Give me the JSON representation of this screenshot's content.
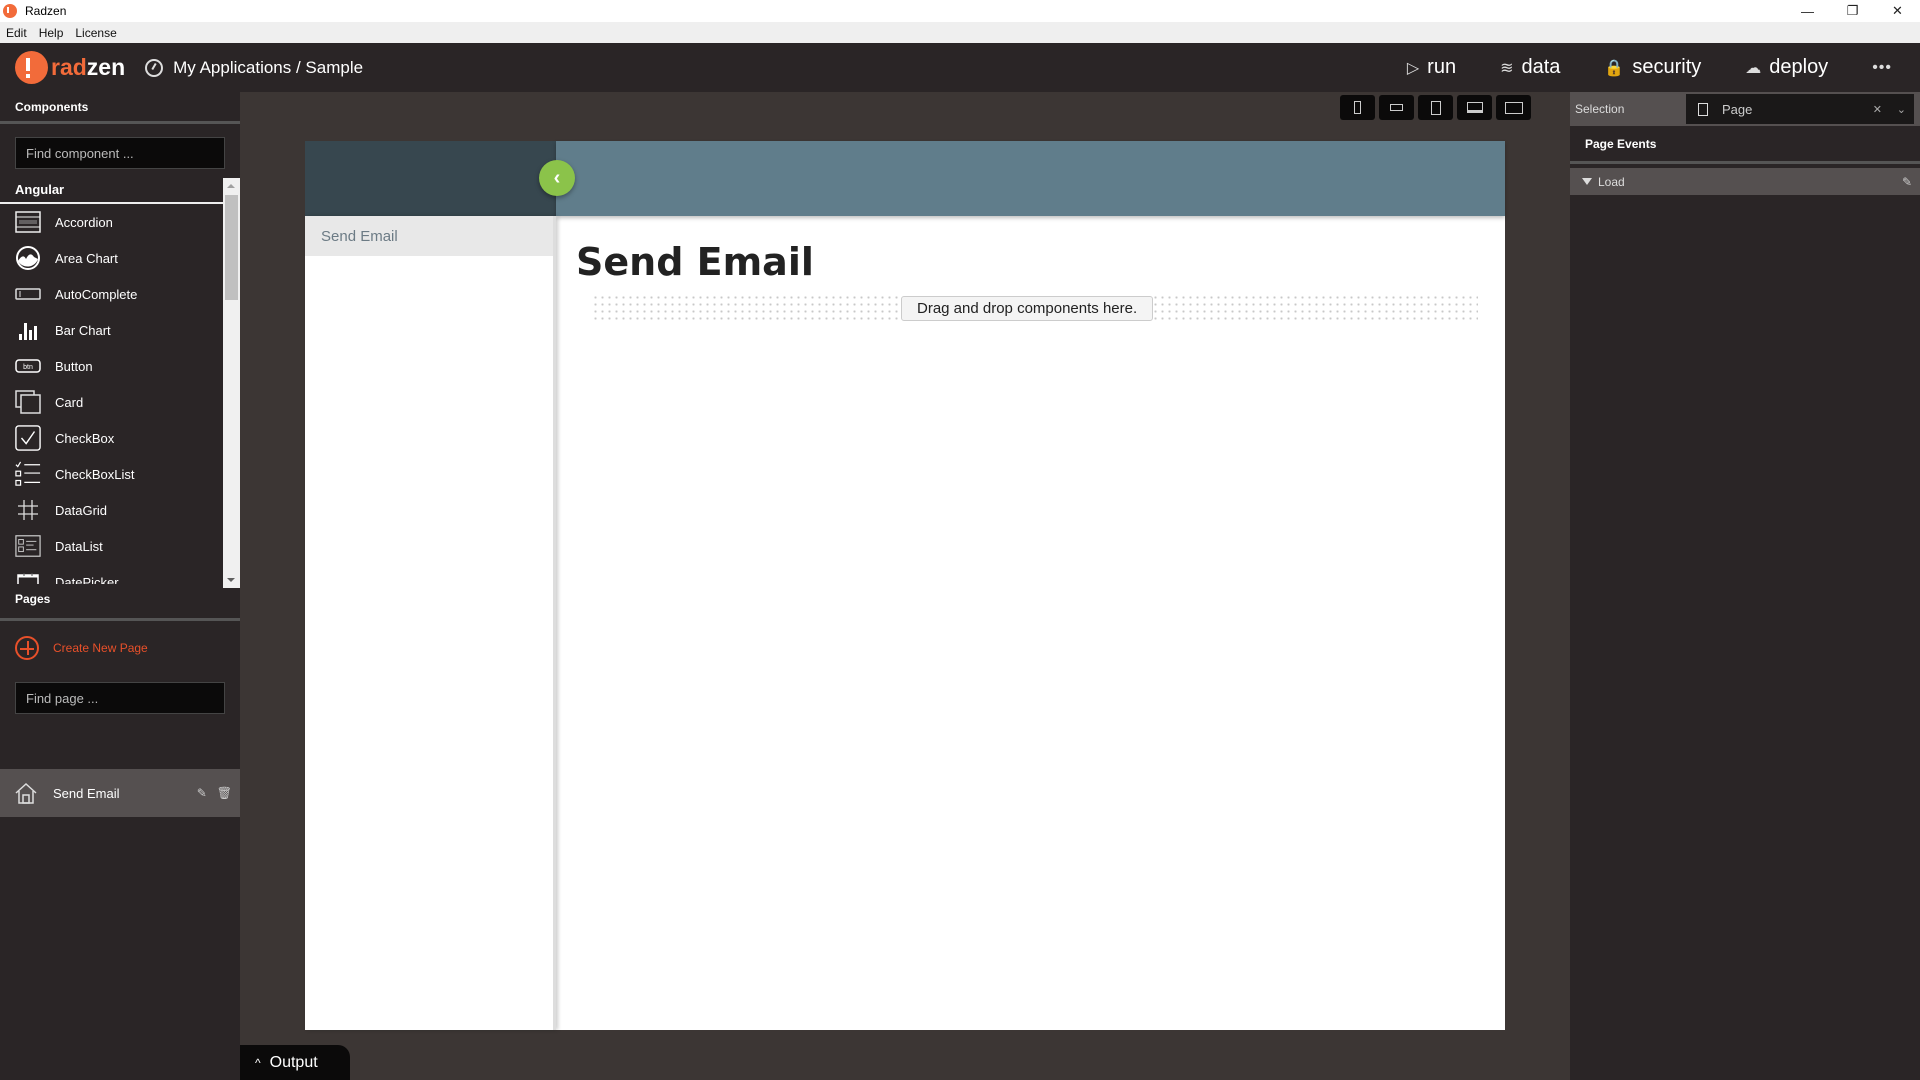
{
  "window": {
    "title": "Radzen",
    "controls": {
      "minimize": "—",
      "restore": "❐",
      "close": "✕"
    }
  },
  "menubar": [
    "Edit",
    "Help",
    "License"
  ],
  "header": {
    "logo_rad": "rad",
    "logo_zen": "zen",
    "breadcrumb": "My Applications / Sample",
    "nav": [
      {
        "label": "run",
        "icon": "▷"
      },
      {
        "label": "data",
        "icon": "≋"
      },
      {
        "label": "security",
        "icon": "🔒"
      },
      {
        "label": "deploy",
        "icon": "☁"
      }
    ],
    "more": "•••"
  },
  "components_panel": {
    "heading": "Components",
    "search_placeholder": "Find component ...",
    "section": "Angular",
    "items": [
      {
        "label": "Accordion",
        "icon": "accordion-icon"
      },
      {
        "label": "Area Chart",
        "icon": "area-chart-icon"
      },
      {
        "label": "AutoComplete",
        "icon": "autocomplete-icon"
      },
      {
        "label": "Bar Chart",
        "icon": "bar-chart-icon"
      },
      {
        "label": "Button",
        "icon": "button-icon"
      },
      {
        "label": "Card",
        "icon": "card-icon"
      },
      {
        "label": "CheckBox",
        "icon": "checkbox-icon"
      },
      {
        "label": "CheckBoxList",
        "icon": "checkbox-list-icon"
      },
      {
        "label": "DataGrid",
        "icon": "datagrid-icon"
      },
      {
        "label": "DataList",
        "icon": "datalist-icon"
      },
      {
        "label": "DatePicker",
        "icon": "datepicker-icon"
      }
    ]
  },
  "pages_panel": {
    "heading": "Pages",
    "create_label": "Create New Page",
    "search_placeholder": "Find page ...",
    "pages": [
      {
        "label": "Send Email"
      }
    ]
  },
  "device_toolbar": [
    "phone-portrait",
    "phone-landscape",
    "tablet",
    "laptop",
    "desktop"
  ],
  "canvas": {
    "sidebar_items": [
      "Send Email"
    ],
    "title": "Send Email",
    "dropzone_label": "Drag and drop components here.",
    "colors": {
      "sidebar_head": "#37474f",
      "header": "#607d8b",
      "toggle": "#8bc34a"
    }
  },
  "right_panel": {
    "selection_label": "Selection",
    "selection_value": "Page",
    "events_heading": "Page Events",
    "events": [
      {
        "label": "Load"
      }
    ]
  },
  "output": {
    "label": "Output"
  },
  "colors": {
    "accent": "#f26b3a",
    "dark_bg": "#2a2526"
  }
}
